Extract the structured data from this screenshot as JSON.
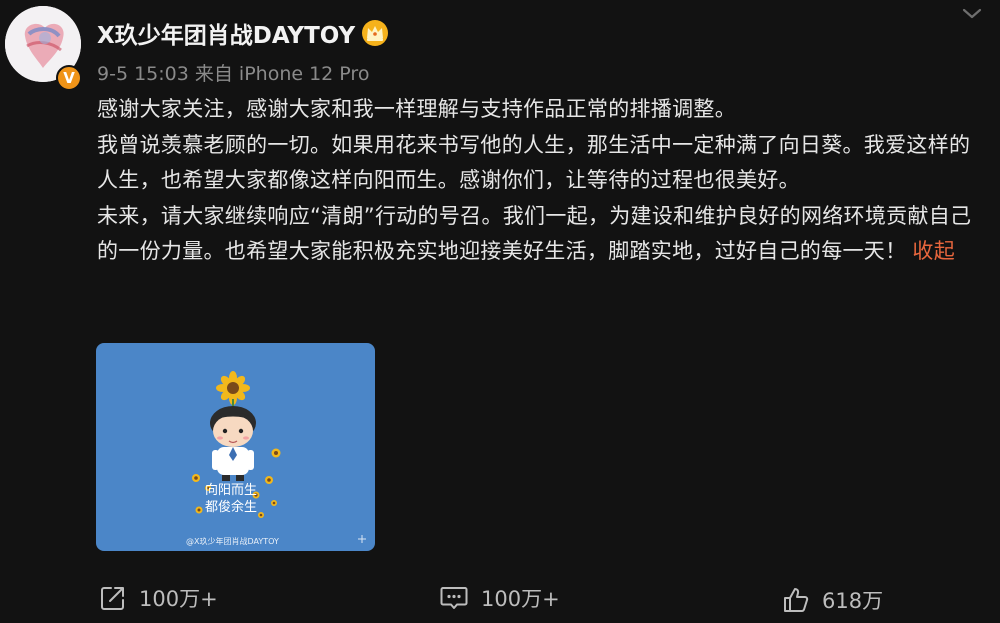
{
  "post": {
    "author": "X玖少年团肖战DAYTOY",
    "verified_badge": "V",
    "timestamp": "9-5 15:03",
    "source": "来自 iPhone 12 Pro",
    "paragraphs": [
      "感谢大家关注，感谢大家和我一样理解与支持作品正常的排播调整。",
      "我曾说羡慕老顾的一切。如果用花来书写他的人生，那生活中一定种满了向日葵。我爱这样的人生，也希望大家都像这样向阳而生。感谢你们，让等待的过程也很美好。",
      "未来，请大家继续响应“清朗”行动的号召。我们一起，为建设和维护良好的网络环境贡献自己的一份力量。也希望大家能积极充实地迎接美好生活，脚踏实地，过好自己的每一天！"
    ],
    "collapse_label": "收起",
    "image_watermark": "@X玖少年团肖战DAYTOY",
    "image_text_line1": "向阳而生",
    "image_text_line2": "都俊余生"
  },
  "actions": {
    "repost_count": "100万+",
    "comment_count": "100万+",
    "like_count": "618万"
  },
  "colors": {
    "background": "#121212",
    "accent": "#e8663d",
    "verified": "#f09418",
    "image_bg": "#4b86c8"
  }
}
